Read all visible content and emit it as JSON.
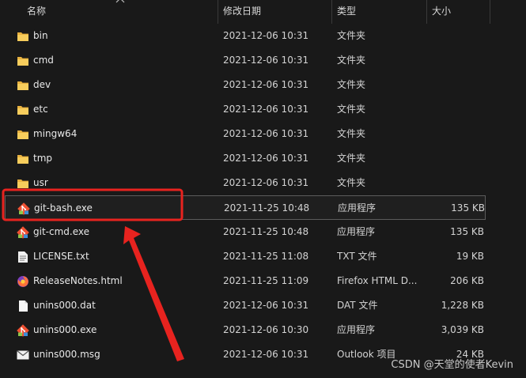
{
  "columns": {
    "name": "名称",
    "date": "修改日期",
    "type": "类型",
    "size": "大小"
  },
  "files": [
    {
      "icon": "folder-icon",
      "name": "bin",
      "date": "2021-12-06 10:31",
      "type": "文件夹",
      "size": ""
    },
    {
      "icon": "folder-icon",
      "name": "cmd",
      "date": "2021-12-06 10:31",
      "type": "文件夹",
      "size": ""
    },
    {
      "icon": "folder-icon",
      "name": "dev",
      "date": "2021-12-06 10:31",
      "type": "文件夹",
      "size": ""
    },
    {
      "icon": "folder-icon",
      "name": "etc",
      "date": "2021-12-06 10:31",
      "type": "文件夹",
      "size": ""
    },
    {
      "icon": "folder-icon",
      "name": "mingw64",
      "date": "2021-12-06 10:31",
      "type": "文件夹",
      "size": ""
    },
    {
      "icon": "folder-icon",
      "name": "tmp",
      "date": "2021-12-06 10:31",
      "type": "文件夹",
      "size": ""
    },
    {
      "icon": "folder-icon",
      "name": "usr",
      "date": "2021-12-06 10:31",
      "type": "文件夹",
      "size": ""
    },
    {
      "icon": "git-icon",
      "name": "git-bash.exe",
      "date": "2021-11-25 10:48",
      "type": "应用程序",
      "size": "135 KB"
    },
    {
      "icon": "git-icon",
      "name": "git-cmd.exe",
      "date": "2021-11-25 10:48",
      "type": "应用程序",
      "size": "135 KB"
    },
    {
      "icon": "text-file-icon",
      "name": "LICENSE.txt",
      "date": "2021-11-25 11:08",
      "type": "TXT 文件",
      "size": "19 KB"
    },
    {
      "icon": "firefox-icon",
      "name": "ReleaseNotes.html",
      "date": "2021-11-25 11:09",
      "type": "Firefox HTML D...",
      "size": "206 KB"
    },
    {
      "icon": "blank-file-icon",
      "name": "unins000.dat",
      "date": "2021-12-06 10:31",
      "type": "DAT 文件",
      "size": "1,228 KB"
    },
    {
      "icon": "git-icon",
      "name": "unins000.exe",
      "date": "2021-12-06 10:30",
      "type": "应用程序",
      "size": "3,039 KB"
    },
    {
      "icon": "mail-icon",
      "name": "unins000.msg",
      "date": "2021-12-06 10:31",
      "type": "Outlook 项目",
      "size": "24 KB"
    }
  ],
  "selected_file": "git-bash.exe",
  "watermark": "CSDN @天堂的使者Kevin",
  "colors": {
    "highlight_box": "#e8231f",
    "arrow": "#e8231f",
    "folder": "#f2c14e"
  }
}
